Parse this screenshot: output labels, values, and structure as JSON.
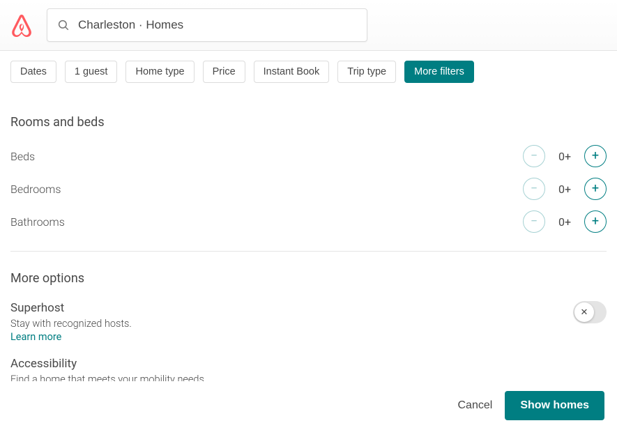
{
  "header": {
    "search_value": "Charleston · Homes"
  },
  "filters": {
    "items": [
      {
        "label": "Dates",
        "active": false
      },
      {
        "label": "1 guest",
        "active": false
      },
      {
        "label": "Home type",
        "active": false
      },
      {
        "label": "Price",
        "active": false
      },
      {
        "label": "Instant Book",
        "active": false
      },
      {
        "label": "Trip type",
        "active": false
      },
      {
        "label": "More filters",
        "active": true
      }
    ]
  },
  "rooms_section": {
    "title": "Rooms and beds",
    "rows": [
      {
        "label": "Beds",
        "value": "0+"
      },
      {
        "label": "Bedrooms",
        "value": "0+"
      },
      {
        "label": "Bathrooms",
        "value": "0+"
      }
    ]
  },
  "more_options": {
    "title": "More options",
    "superhost": {
      "title": "Superhost",
      "desc": "Stay with recognized hosts.",
      "learn_more": "Learn more",
      "toggle_on": false
    },
    "accessibility": {
      "title": "Accessibility",
      "desc": "Find a home that meets your mobility needs."
    }
  },
  "footer": {
    "cancel": "Cancel",
    "submit": "Show homes"
  },
  "colors": {
    "brand_red": "#FF5A5F",
    "teal": "#007e82"
  }
}
